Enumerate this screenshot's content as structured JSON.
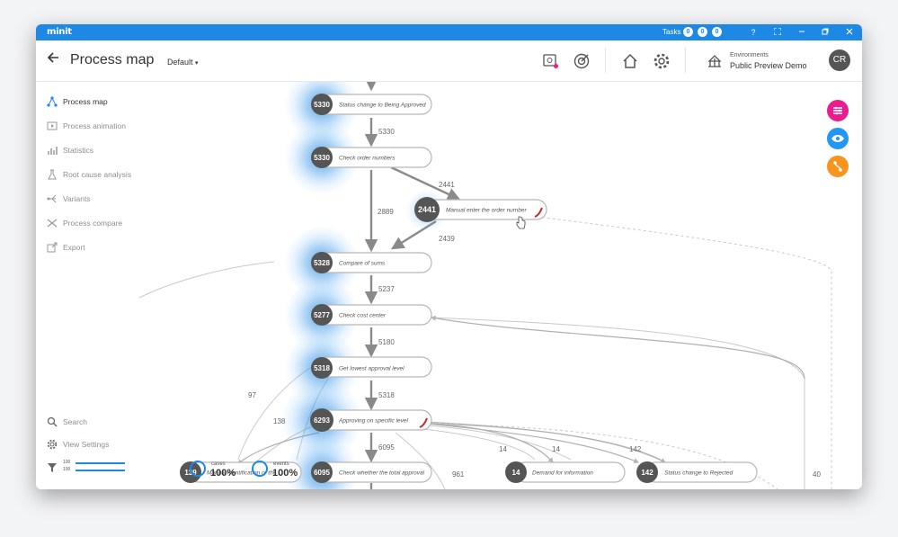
{
  "titlebar": {
    "logo": "minit",
    "tasks_label": "Tasks",
    "task_counts": [
      "0",
      "0",
      "0"
    ],
    "help": "?"
  },
  "header": {
    "title": "Process map",
    "view_selector": "Default",
    "env_label": "Environments",
    "env_value": "Public Preview Demo",
    "avatar": "CR"
  },
  "sidebar": {
    "items": [
      {
        "label": "Process map",
        "icon": "process-map-icon",
        "active": true
      },
      {
        "label": "Process animation",
        "icon": "animation-icon",
        "active": false
      },
      {
        "label": "Statistics",
        "icon": "statistics-icon",
        "active": false
      },
      {
        "label": "Root cause analysis",
        "icon": "root-cause-icon",
        "active": false
      },
      {
        "label": "Variants",
        "icon": "variants-icon",
        "active": false
      },
      {
        "label": "Process compare",
        "icon": "compare-icon",
        "active": false
      },
      {
        "label": "Export",
        "icon": "export-icon",
        "active": false
      }
    ],
    "search": "Search",
    "view_settings": "View Settings",
    "filter_values": [
      "100",
      "100"
    ]
  },
  "map": {
    "nodes": [
      {
        "count": "5330",
        "label": "Status change to Being Approved"
      },
      {
        "count": "5330",
        "label": "Check order numbers"
      },
      {
        "count": "2441",
        "label": "Manual enter the order number"
      },
      {
        "count": "5328",
        "label": "Compare of sums"
      },
      {
        "count": "5277",
        "label": "Check cost center"
      },
      {
        "count": "5318",
        "label": "Get lowest approval level"
      },
      {
        "count": "6293",
        "label": "Approving on specific level"
      },
      {
        "count": "6095",
        "label": "Check whether the total approval"
      },
      {
        "count": "14",
        "label": "Demand for information"
      },
      {
        "count": "142",
        "label": "Status change to Rejected"
      },
      {
        "count": "139",
        "label": "Manual identification of the ..."
      }
    ],
    "edges": {
      "e_top": "5330",
      "e_check_manual": "2441",
      "e_check_compare": "2889",
      "e_manual_compare": "2439",
      "e_compare_cost": "5237",
      "e_cost_lowest": "5180",
      "e_lowest_approving": "5318",
      "e_approving_check": "6095",
      "e_97": "97",
      "e_138": "138",
      "e_14a": "14",
      "e_14b": "14",
      "e_142": "142",
      "e_961": "961",
      "e_40": "40"
    },
    "overlay": {
      "cases_label": "cases",
      "cases_value": "100%",
      "events_label": "events",
      "events_value": "100%"
    }
  },
  "colors": {
    "titlebar": "#1e88e5",
    "fab_filter": "#e91e8c",
    "fab_view": "#2196f3",
    "fab_path": "#f7941d",
    "node_badge": "#555555",
    "glow": "#1e88e5"
  }
}
